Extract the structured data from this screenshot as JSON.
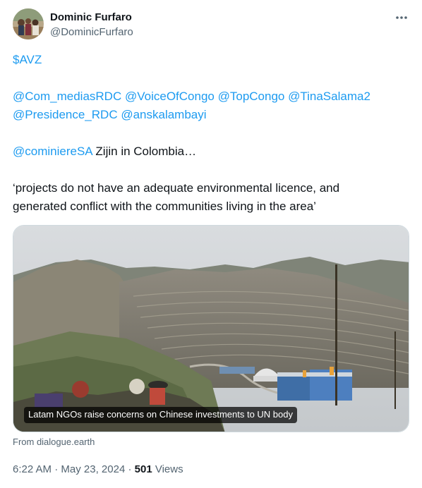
{
  "author": {
    "display_name": "Dominic Furfaro",
    "handle": "@DominicFurfaro"
  },
  "tweet": {
    "line1": {
      "text": "$AVZ"
    },
    "mentions_row1": [
      "@Com_mediasRDC",
      "@VoiceOfCongo",
      "@TopCongo",
      "@TinaSalama2"
    ],
    "mentions_row2": [
      "@Presidence_RDC",
      "@anskalambayi"
    ],
    "line3": {
      "mention": "@cominiereSA",
      "text": " Zijin in Colombia…"
    },
    "quote_line1": "‘projects do not have an adequate environmental licence, and",
    "quote_line2": "generated conflict with the communities living in the area’"
  },
  "card": {
    "caption": "Latam NGOs raise concerns on Chinese investments to UN body",
    "source": "From dialogue.earth"
  },
  "meta": {
    "time": "6:22 AM",
    "separator": "·",
    "date": "May 23, 2024",
    "views_count": "501",
    "views_label": "Views"
  },
  "icons": {
    "more": "more-horizontal-icon"
  },
  "colors": {
    "link": "#1d9bf0",
    "text": "#0f1419",
    "secondary": "#536471"
  }
}
